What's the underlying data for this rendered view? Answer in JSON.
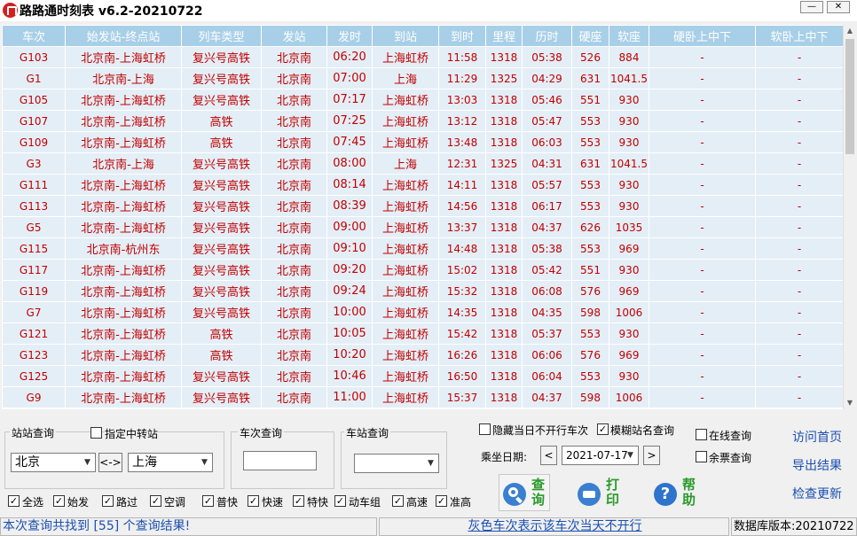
{
  "window": {
    "title": "路路通时刻表 v6.2-20210722",
    "min_label": "—",
    "close_label": "✕"
  },
  "table": {
    "headers": [
      "车次",
      "始发站-终点站",
      "列车类型",
      "发站",
      "发时",
      "到站",
      "到时",
      "里程",
      "历时",
      "硬座",
      "软座",
      "硬卧上中下",
      "软卧上中下"
    ],
    "rows": [
      [
        "G103",
        "北京南-上海虹桥",
        "复兴号高铁",
        "北京南",
        "06:20",
        "上海虹桥",
        "11:58",
        "1318",
        "05:38",
        "526",
        "884",
        "-",
        "-"
      ],
      [
        "G1",
        "北京南-上海",
        "复兴号高铁",
        "北京南",
        "07:00",
        "上海",
        "11:29",
        "1325",
        "04:29",
        "631",
        "1041.5",
        "-",
        "-"
      ],
      [
        "G105",
        "北京南-上海虹桥",
        "复兴号高铁",
        "北京南",
        "07:17",
        "上海虹桥",
        "13:03",
        "1318",
        "05:46",
        "551",
        "930",
        "-",
        "-"
      ],
      [
        "G107",
        "北京南-上海虹桥",
        "高铁",
        "北京南",
        "07:25",
        "上海虹桥",
        "13:12",
        "1318",
        "05:47",
        "553",
        "930",
        "-",
        "-"
      ],
      [
        "G109",
        "北京南-上海虹桥",
        "高铁",
        "北京南",
        "07:45",
        "上海虹桥",
        "13:48",
        "1318",
        "06:03",
        "553",
        "930",
        "-",
        "-"
      ],
      [
        "G3",
        "北京南-上海",
        "复兴号高铁",
        "北京南",
        "08:00",
        "上海",
        "12:31",
        "1325",
        "04:31",
        "631",
        "1041.5",
        "-",
        "-"
      ],
      [
        "G111",
        "北京南-上海虹桥",
        "复兴号高铁",
        "北京南",
        "08:14",
        "上海虹桥",
        "14:11",
        "1318",
        "05:57",
        "553",
        "930",
        "-",
        "-"
      ],
      [
        "G113",
        "北京南-上海虹桥",
        "复兴号高铁",
        "北京南",
        "08:39",
        "上海虹桥",
        "14:56",
        "1318",
        "06:17",
        "553",
        "930",
        "-",
        "-"
      ],
      [
        "G5",
        "北京南-上海虹桥",
        "复兴号高铁",
        "北京南",
        "09:00",
        "上海虹桥",
        "13:37",
        "1318",
        "04:37",
        "626",
        "1035",
        "-",
        "-"
      ],
      [
        "G115",
        "北京南-杭州东",
        "复兴号高铁",
        "北京南",
        "09:10",
        "上海虹桥",
        "14:48",
        "1318",
        "05:38",
        "553",
        "969",
        "-",
        "-"
      ],
      [
        "G117",
        "北京南-上海虹桥",
        "复兴号高铁",
        "北京南",
        "09:20",
        "上海虹桥",
        "15:02",
        "1318",
        "05:42",
        "551",
        "930",
        "-",
        "-"
      ],
      [
        "G119",
        "北京南-上海虹桥",
        "复兴号高铁",
        "北京南",
        "09:24",
        "上海虹桥",
        "15:32",
        "1318",
        "06:08",
        "576",
        "969",
        "-",
        "-"
      ],
      [
        "G7",
        "北京南-上海虹桥",
        "复兴号高铁",
        "北京南",
        "10:00",
        "上海虹桥",
        "14:35",
        "1318",
        "04:35",
        "598",
        "1006",
        "-",
        "-"
      ],
      [
        "G121",
        "北京南-上海虹桥",
        "高铁",
        "北京南",
        "10:05",
        "上海虹桥",
        "15:42",
        "1318",
        "05:37",
        "553",
        "930",
        "-",
        "-"
      ],
      [
        "G123",
        "北京南-上海虹桥",
        "高铁",
        "北京南",
        "10:20",
        "上海虹桥",
        "16:26",
        "1318",
        "06:06",
        "576",
        "969",
        "-",
        "-"
      ],
      [
        "G125",
        "北京南-上海虹桥",
        "复兴号高铁",
        "北京南",
        "10:46",
        "上海虹桥",
        "16:50",
        "1318",
        "06:04",
        "553",
        "930",
        "-",
        "-"
      ],
      [
        "G9",
        "北京南-上海虹桥",
        "复兴号高铁",
        "北京南",
        "11:00",
        "上海虹桥",
        "15:37",
        "1318",
        "04:37",
        "598",
        "1006",
        "-",
        "-"
      ]
    ]
  },
  "station_query": {
    "label": "站站查询",
    "transfer_label": "指定中转站",
    "from": "北京",
    "to": "上海",
    "swap_label": "<->"
  },
  "train_query": {
    "label": "车次查询",
    "value": ""
  },
  "stop_query": {
    "label": "车站查询",
    "value": ""
  },
  "options": {
    "hide_label": "隐藏当日不开行车次",
    "hide_checked": false,
    "fuzzy_label": "模糊站名查询",
    "fuzzy_checked": true,
    "online_label": "在线查询",
    "online_checked": false,
    "ticket_label": "余票查询",
    "ticket_checked": false
  },
  "date": {
    "label": "乘坐日期:",
    "value": "2021-07-17",
    "prev_label": "<",
    "next_label": ">"
  },
  "filters": [
    {
      "label": "全选",
      "checked": true
    },
    {
      "label": "始发",
      "checked": true
    },
    {
      "label": "路过",
      "checked": true
    },
    {
      "label": "空调",
      "checked": true
    },
    {
      "label": "普快",
      "checked": true
    },
    {
      "label": "快速",
      "checked": true
    },
    {
      "label": "特快",
      "checked": true
    },
    {
      "label": "动车组",
      "checked": true
    },
    {
      "label": "高速",
      "checked": true
    },
    {
      "label": "准高",
      "checked": true
    }
  ],
  "buttons": {
    "search_label": "查询",
    "print_label": "打印",
    "help_label": "帮助",
    "help_glyph": "?"
  },
  "links": {
    "home": "访问首页",
    "export": "导出结果",
    "update": "检查更新"
  },
  "status": {
    "result_text": "本次查询共找到 [55] 个查询结果!",
    "hint_text": "灰色车次表示该车次当天不开行",
    "db_text": "数据库版本:20210722"
  },
  "colors": {
    "header_bg": "#a8cfe8",
    "row_bg": "#e4eef6",
    "cell_text": "#c00000",
    "link": "#1a4fb0",
    "button_text": "#2a9a2a"
  },
  "icons": {
    "app": "train-app-icon",
    "search": "magnifier-icon",
    "print": "printer-icon",
    "help": "help-icon"
  }
}
